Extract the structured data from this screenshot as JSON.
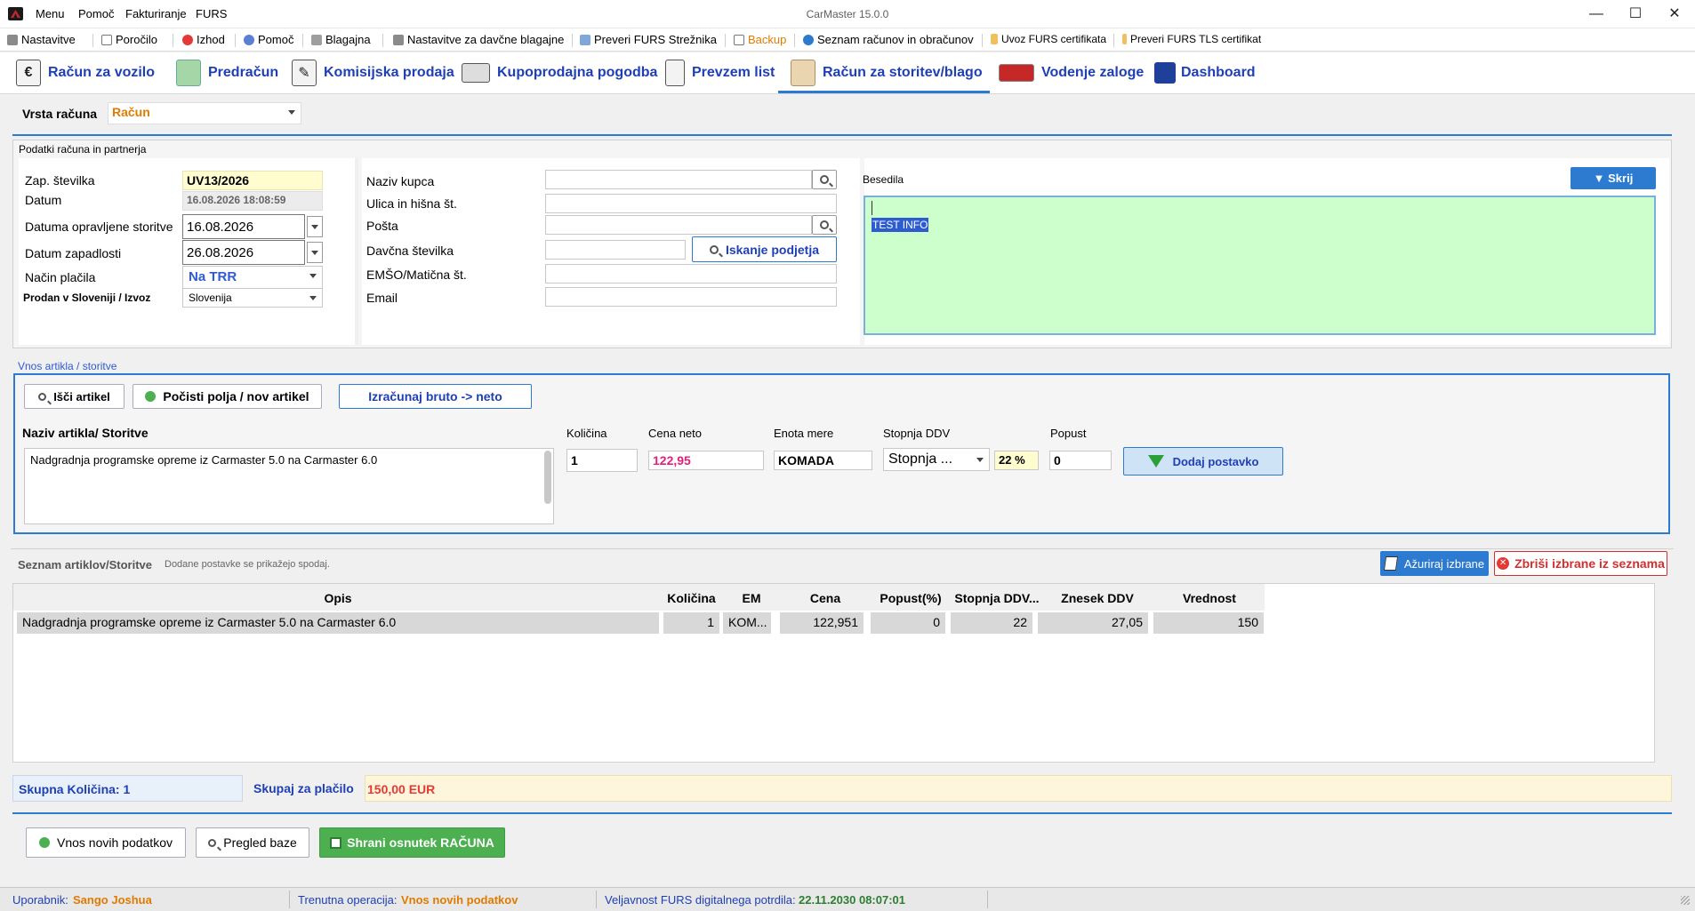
{
  "window": {
    "title": "CarMaster 15.0.0",
    "menu": [
      "Menu",
      "Pomoč",
      "Fakturiranje",
      "FURS"
    ],
    "controls": {
      "minimize": "—",
      "maximize": "☐",
      "close": "✕"
    }
  },
  "toolbar": {
    "items": [
      "Nastavitve",
      "Poročilo",
      "Izhod",
      "Pomoč",
      "Blagajna",
      "Nastavitve za davčne blagajne",
      "Preveri FURS Strežnika",
      "Backup",
      "Seznam računov in obračunov",
      "Uvoz FURS certifikata",
      "Preveri FURS TLS certifikat"
    ]
  },
  "tabs": [
    {
      "label": "Račun za vozilo",
      "icon": "invoice-euro-icon"
    },
    {
      "label": "Predračun",
      "icon": "cash-icon"
    },
    {
      "label": "Komisijska prodaja",
      "icon": "contract-icon"
    },
    {
      "label": "Kupoprodajna pogodba",
      "icon": "money-stack-icon"
    },
    {
      "label": "Prevzem list",
      "icon": "clipboard-icon"
    },
    {
      "label": "Račun za storitev/blago",
      "icon": "package-icon",
      "active": true
    },
    {
      "label": "Vodenje zaloge",
      "icon": "cars-icon"
    },
    {
      "label": "Dashboard",
      "icon": "bar-chart-icon"
    }
  ],
  "invoice_type": {
    "label": "Vrsta računa",
    "value": "Račun"
  },
  "partner_section": {
    "title": "Podatki računa in partnerja",
    "zap_label": "Zap. številka",
    "zap_value": "UV13/2026",
    "datum_label": "Datum",
    "datum_value": "16.08.2026 18:08:59",
    "opravljene_label": "Datuma opravljene storitve",
    "opravljene_value": "16.08.2026",
    "zapadlosti_label": "Datum zapadlosti",
    "zapadlosti_value": "26.08.2026",
    "nacin_label": "Način plačila",
    "nacin_value": "Na TRR",
    "prodan_label": "Prodan v Sloveniji / Izvoz",
    "prodan_value": "Slovenija",
    "naziv_label": "Naziv kupca",
    "naziv_value": "",
    "ulica_label": "Ulica in hišna št.",
    "ulica_value": "",
    "posta_label": "Pošta",
    "posta_value": "",
    "davcna_label": "Davčna številka",
    "davcna_value": "",
    "emso_label": "EMŠO/Matična št.",
    "emso_value": "",
    "email_label": "Email",
    "email_value": "",
    "iskanje_button": "Iskanje podjetja",
    "besedila_label": "Besedila",
    "besedila_value": "TEST INFO",
    "skrij_button": "▼ Skrij"
  },
  "article_section": {
    "title": "Vnos artikla / storitve",
    "search_button": "Išči artikel",
    "clear_button": "Počisti polja / nov artikel",
    "calc_button": "Izračunaj bruto -> neto",
    "name_label": "Naziv artikla/ Storitve",
    "name_value": "Nadgradnja programske opreme iz Carmaster 5.0 na Carmaster 6.0",
    "qty_label": "Količina",
    "qty_value": "1",
    "price_label": "Cena neto",
    "price_value": "122,95",
    "unit_label": "Enota mere",
    "unit_value": "KOMADA",
    "vat_label": "Stopnja DDV",
    "vat_select": "Stopnja ...",
    "vat_value": "22 %",
    "discount_label": "Popust",
    "discount_value": "0",
    "add_button": "Dodaj postavko"
  },
  "list_section": {
    "title": "Seznam artiklov/Storitve",
    "hint": "Dodane postavke se prikažejo spodaj.",
    "update_button": "Ažuriraj izbrane",
    "delete_button": "Zbriši izbrane iz seznama",
    "columns": [
      "Opis",
      "Količina",
      "EM",
      "Cena",
      "Popust(%)",
      "Stopnja DDV...",
      "Znesek DDV",
      "Vrednost"
    ],
    "rows": [
      [
        "Nadgradnja programske opreme iz Carmaster 5.0 na Carmaster 6.0",
        "1",
        "KOM...",
        "122,951",
        "0",
        "22",
        "27,05",
        "150"
      ]
    ]
  },
  "totals": {
    "qty_label": "Skupna Količina: 1",
    "pay_label": "Skupaj za plačilo",
    "pay_value": "150,00 EUR"
  },
  "actions": {
    "new_button": "Vnos novih podatkov",
    "browse_button": "Pregled baze",
    "save_button": "Shrani osnutek RAČUNA"
  },
  "status": {
    "user_label": "Uporabnik:",
    "user_value": "Sango Joshua",
    "op_label": "Trenutna operacija:",
    "op_value": "Vnos novih podatkov",
    "cert_label": "Veljavnost FURS digitalnega potrdila:",
    "cert_value": "22.11.2030 08:07:01"
  },
  "colors": {
    "accent": "#2d7bd1",
    "tab_text": "#1f3fb5",
    "orange": "#e07b00",
    "notes_bg": "#ccffcc",
    "save_green": "#4caf50",
    "delete_red": "#d32f2f",
    "price_pink": "#e0207a",
    "yellow_field": "#fffccf"
  }
}
